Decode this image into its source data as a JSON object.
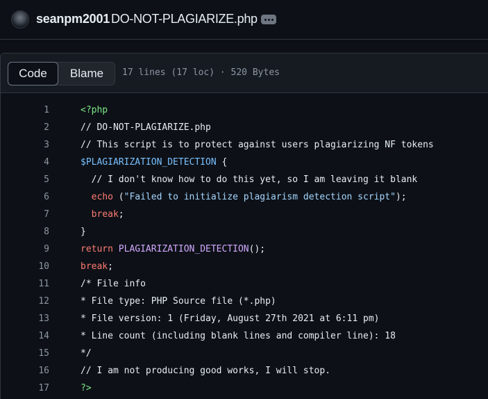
{
  "header": {
    "owner": "seanpm2001",
    "filename": "DO-NOT-PLAGIARIZE.php"
  },
  "toolbar": {
    "code_label": "Code",
    "blame_label": "Blame",
    "file_info": "17 lines (17 loc) · 520 Bytes"
  },
  "colors": {
    "background": "#0d1117",
    "toolbar": "#161b22",
    "border": "#30363d",
    "line_number": "#8d96a0",
    "php_tag": "#7ee787",
    "variable": "#79c0ff",
    "keyword": "#ff7b72",
    "function": "#d2a8ff",
    "string": "#a5d6ff"
  },
  "code": {
    "lines": [
      {
        "n": "1",
        "tokens": [
          {
            "t": "<?php",
            "c": "tag"
          }
        ]
      },
      {
        "n": "2",
        "tokens": [
          {
            "t": "// DO-NOT-PLAGIARIZE.php",
            "c": "com"
          }
        ]
      },
      {
        "n": "3",
        "tokens": [
          {
            "t": "// This script is to protect against users plagiarizing NF tokens",
            "c": "com"
          }
        ]
      },
      {
        "n": "4",
        "tokens": [
          {
            "t": "$PLAGIARIZATION_DETECTION",
            "c": "var"
          },
          {
            "t": " {",
            "c": "pun"
          }
        ]
      },
      {
        "n": "5",
        "tokens": [
          {
            "t": "  // I don't know how to do this yet, so I am leaving it blank",
            "c": "com"
          }
        ]
      },
      {
        "n": "6",
        "tokens": [
          {
            "t": "  echo",
            "c": "kw"
          },
          {
            "t": " (",
            "c": "pun"
          },
          {
            "t": "\"Failed to initialize plagiarism detection script\"",
            "c": "str"
          },
          {
            "t": ");",
            "c": "pun"
          }
        ]
      },
      {
        "n": "7",
        "tokens": [
          {
            "t": "  break",
            "c": "kw"
          },
          {
            "t": ";",
            "c": "pun"
          }
        ]
      },
      {
        "n": "8",
        "tokens": [
          {
            "t": "}",
            "c": "pun"
          }
        ]
      },
      {
        "n": "9",
        "tokens": [
          {
            "t": "return",
            "c": "kw"
          },
          {
            "t": " PLAGIARIZATION_DETECTION",
            "c": "fn"
          },
          {
            "t": "();",
            "c": "pun"
          }
        ]
      },
      {
        "n": "10",
        "tokens": [
          {
            "t": "break",
            "c": "kw"
          },
          {
            "t": ";",
            "c": "pun"
          }
        ]
      },
      {
        "n": "11",
        "tokens": [
          {
            "t": "/* File info",
            "c": "com"
          }
        ]
      },
      {
        "n": "12",
        "tokens": [
          {
            "t": "* File type: PHP Source file (*.php)",
            "c": "com"
          }
        ]
      },
      {
        "n": "13",
        "tokens": [
          {
            "t": "* File version: 1 (Friday, August 27th 2021 at 6:11 pm)",
            "c": "com"
          }
        ]
      },
      {
        "n": "14",
        "tokens": [
          {
            "t": "* Line count (including blank lines and compiler line): 18",
            "c": "com"
          }
        ]
      },
      {
        "n": "15",
        "tokens": [
          {
            "t": "*/",
            "c": "com"
          }
        ]
      },
      {
        "n": "16",
        "tokens": [
          {
            "t": "// I am not producing good works, I will stop.",
            "c": "com"
          }
        ]
      },
      {
        "n": "17",
        "tokens": [
          {
            "t": "?>",
            "c": "tag"
          }
        ]
      }
    ]
  }
}
